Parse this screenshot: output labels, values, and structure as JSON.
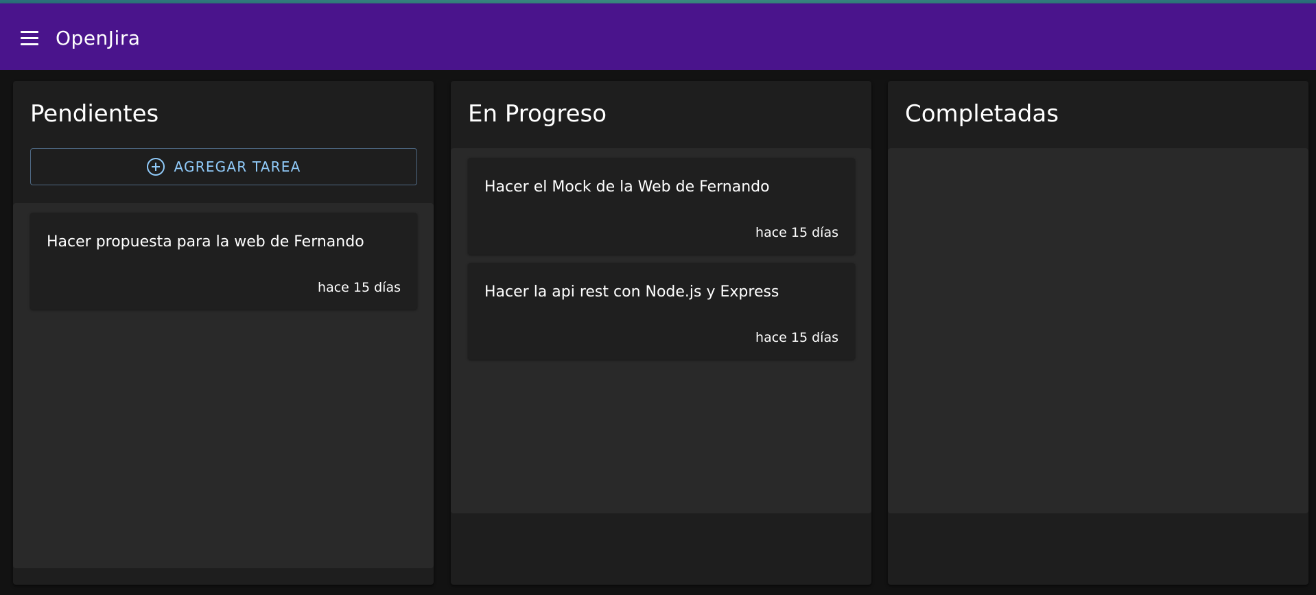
{
  "app": {
    "title": "OpenJira"
  },
  "columns": [
    {
      "title": "Pendientes",
      "add_label": "AGREGAR TAREA",
      "cards": [
        {
          "description": "Hacer propuesta para la web de Fernando",
          "time": "hace 15 días"
        }
      ]
    },
    {
      "title": "En Progreso",
      "cards": [
        {
          "description": "Hacer el Mock de la Web de Fernando",
          "time": "hace 15 días"
        },
        {
          "description": "Hacer la api rest con Node.js y Express",
          "time": "hace 15 días"
        }
      ]
    },
    {
      "title": "Completadas",
      "cards": []
    }
  ],
  "colors": {
    "appbar": "#4a148c",
    "background": "#121212",
    "accent": "#90caf9"
  },
  "icons": {
    "menu": "menu-icon",
    "add": "add-circle-icon"
  }
}
